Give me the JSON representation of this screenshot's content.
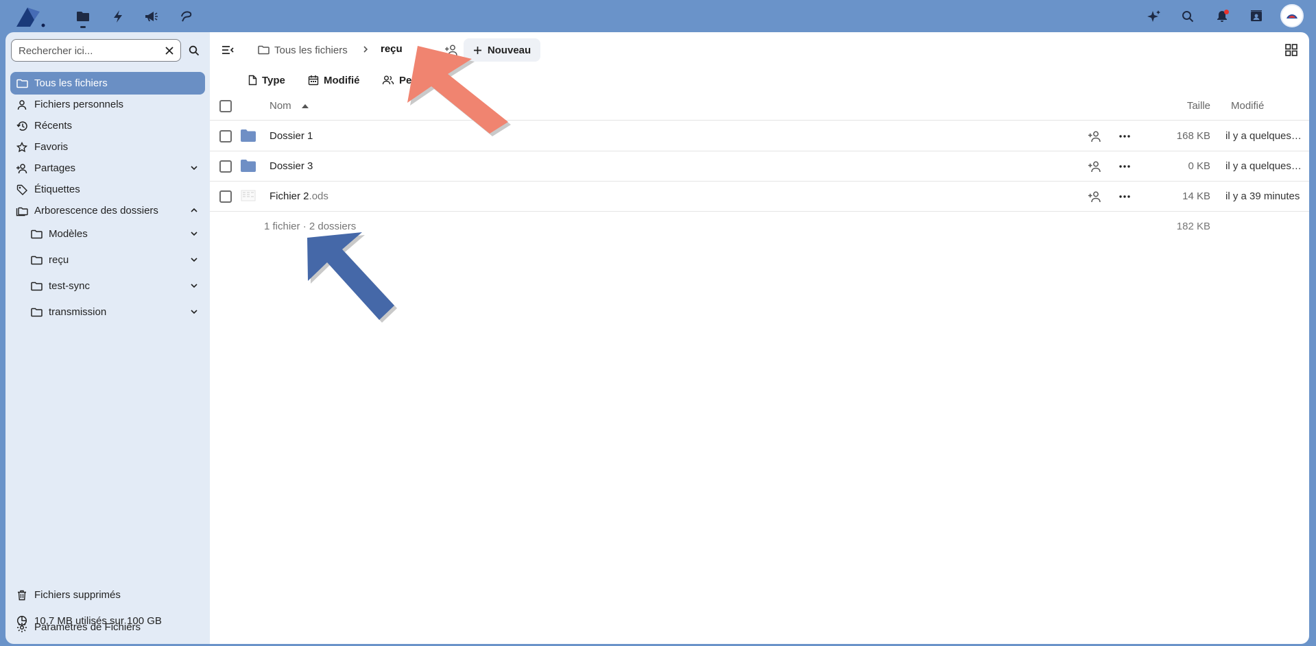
{
  "top_bar": {
    "apps": [
      {
        "name": "files-icon"
      },
      {
        "name": "activity-icon"
      },
      {
        "name": "announcements-icon"
      },
      {
        "name": "notes-icon"
      }
    ],
    "right_icons": [
      "assistant-icon",
      "search-icon",
      "notifications-icon",
      "contacts-icon"
    ]
  },
  "sidebar": {
    "search_placeholder": "Rechercher ici...",
    "items": [
      {
        "label": "Tous les fichiers",
        "icon": "folder-icon",
        "active": true
      },
      {
        "label": "Fichiers personnels",
        "icon": "user-icon"
      },
      {
        "label": "Récents",
        "icon": "history-icon"
      },
      {
        "label": "Favoris",
        "icon": "star-icon"
      },
      {
        "label": "Partages",
        "icon": "share-icon"
      },
      {
        "label": "Étiquettes",
        "icon": "tag-icon"
      },
      {
        "label": "Arborescence des dossiers",
        "icon": "folder-tree-icon"
      }
    ],
    "tree": [
      {
        "label": "Modèles"
      },
      {
        "label": "reçu"
      },
      {
        "label": "test-sync"
      },
      {
        "label": "transmission"
      }
    ],
    "footer": {
      "trash": "Fichiers supprimés",
      "quota": "10,7 MB utilisés sur 100 GB",
      "settings": "Paramètres de Fichiers"
    }
  },
  "content": {
    "breadcrumb_root": "Tous les fichiers",
    "breadcrumb_current": "reçu",
    "new_label": "Nouveau",
    "filters": {
      "type": "Type",
      "modified": "Modifié",
      "people": "Pe"
    },
    "columns": {
      "name": "Nom",
      "size": "Taille",
      "modified": "Modifié"
    },
    "rows": [
      {
        "name": "Dossier 1",
        "ext": "",
        "size": "168 KB",
        "modified": "il y a quelques secondes"
      },
      {
        "name": "Dossier 3",
        "ext": "",
        "size": "0 KB",
        "modified": "il y a quelques secondes"
      },
      {
        "name": "Fichier 2",
        "ext": ".ods",
        "size": "14 KB",
        "modified": "il y a 39 minutes"
      }
    ],
    "summary": "1 fichier · 2 dossiers",
    "summary_size": "182 KB"
  },
  "colors": {
    "accent": "#6a8fc4",
    "top_bar": "#6a93c9",
    "folder": "#6f8fc5",
    "annotation_arrow_red": "#f08470",
    "annotation_arrow_blue": "#4568a8"
  }
}
